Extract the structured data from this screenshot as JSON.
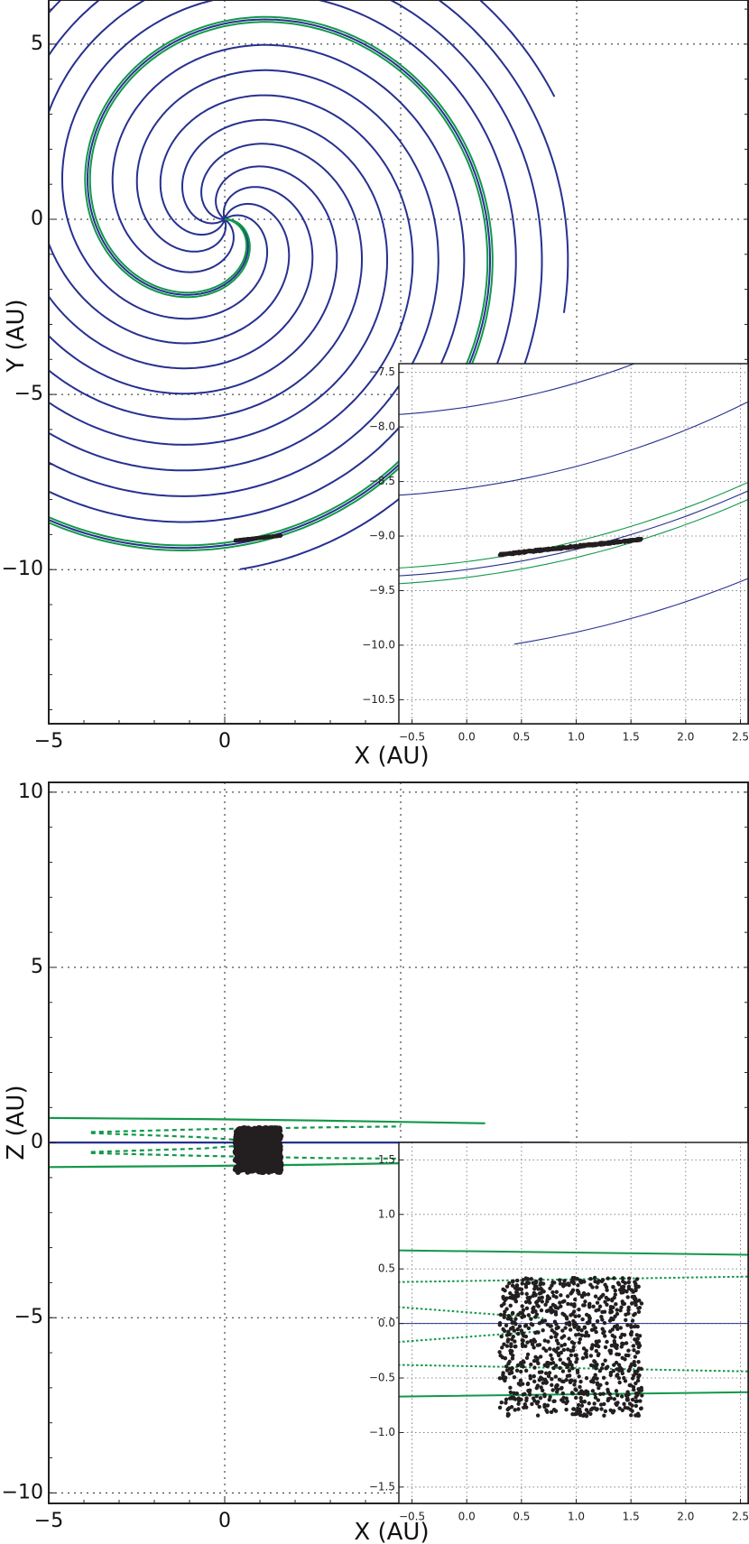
{
  "colors": {
    "field_line": "#27308f",
    "tilted_line": "#12984a",
    "particles": "#231f20",
    "grid": "#222222",
    "inset_grid": "#888888"
  },
  "chart_data": [
    {
      "id": "xy-main",
      "type": "line",
      "xlabel": "X (AU)",
      "ylabel": "Y (AU)",
      "xlim": [
        -5,
        14.87
      ],
      "ylim": [
        -14.4,
        6.26
      ],
      "grid": true,
      "xticks": [
        {
          "value": -5,
          "label": "−5"
        },
        {
          "value": 0,
          "label": "0"
        },
        {
          "value": 5,
          "label": ""
        },
        {
          "value": 10,
          "label": ""
        }
      ],
      "yticks": [
        {
          "value": 5,
          "label": "5"
        },
        {
          "value": 0,
          "label": "0"
        },
        {
          "value": -5,
          "label": "−5"
        },
        {
          "value": -10,
          "label": "−10"
        }
      ],
      "spiral_blue": {
        "arms": 10,
        "arm_start_angles_deg": [
          0,
          36,
          72,
          108,
          144,
          180,
          216,
          252,
          288,
          324
        ],
        "r_per_radian_au": 1.185,
        "r_max_au": 10
      },
      "spiral_green": {
        "arm_start_angles_deg": [
          -3.5,
          3.5
        ],
        "r_per_radian_au": 1.185,
        "r_max_au": 10.05
      },
      "particles": {
        "x_range": [
          0.3,
          1.6
        ],
        "y_at_x_min": -9.17,
        "y_at_x_max": -9.03,
        "count": 500
      }
    },
    {
      "id": "xy-inset",
      "type": "line",
      "xlim": [
        -0.62,
        2.57
      ],
      "ylim": [
        -10.72,
        -7.42
      ],
      "grid": true,
      "xticks": [
        {
          "value": -0.5,
          "label": "−0.5"
        },
        {
          "value": 0,
          "label": "0.0"
        },
        {
          "value": 0.5,
          "label": "0.5"
        },
        {
          "value": 1,
          "label": "1.0"
        },
        {
          "value": 1.5,
          "label": "1.5"
        },
        {
          "value": 2,
          "label": "2.0"
        },
        {
          "value": 2.5,
          "label": "2.5"
        }
      ],
      "yticks": [
        {
          "value": -7.5,
          "label": "−7.5"
        },
        {
          "value": -8,
          "label": "−8.0"
        },
        {
          "value": -8.5,
          "label": "−8.5"
        },
        {
          "value": -9,
          "label": "−9.0"
        },
        {
          "value": -9.5,
          "label": "−9.5"
        },
        {
          "value": -10,
          "label": "−10.0"
        },
        {
          "value": -10.5,
          "label": "−10.5"
        }
      ]
    },
    {
      "id": "xz-main",
      "type": "line",
      "xlabel": "X (AU)",
      "ylabel": "Z (AU)",
      "xlim": [
        -5,
        14.87
      ],
      "ylim": [
        -10.3,
        10.28
      ],
      "grid": true,
      "xticks": [
        {
          "value": -5,
          "label": "−5"
        },
        {
          "value": 0,
          "label": "0"
        },
        {
          "value": 5,
          "label": ""
        },
        {
          "value": 10,
          "label": ""
        }
      ],
      "yticks": [
        {
          "value": 10,
          "label": "10"
        },
        {
          "value": 5,
          "label": "5"
        },
        {
          "value": 0,
          "label": "0"
        },
        {
          "value": -5,
          "label": "−5"
        },
        {
          "value": -10,
          "label": "−10"
        }
      ],
      "lines": [
        {
          "color": "field_line",
          "style": "solid",
          "points": [
            [
              -5,
              0
            ],
            [
              9.8,
              0
            ]
          ]
        },
        {
          "color": "tilted_line",
          "style": "solid",
          "points": [
            [
              -5,
              0.7
            ],
            [
              -0.62,
              0.67
            ],
            [
              2.6,
              0.63
            ],
            [
              7.4,
              0.55
            ]
          ]
        },
        {
          "color": "tilted_line",
          "style": "solid",
          "points": [
            [
              -5,
              -0.7
            ],
            [
              -0.62,
              -0.67
            ],
            [
              2.6,
              -0.63
            ],
            [
              7.4,
              -0.55
            ]
          ]
        },
        {
          "color": "tilted_line",
          "style": "dotted",
          "points": [
            [
              -3.8,
              0.3
            ],
            [
              -0.62,
              0.38
            ],
            [
              2.6,
              0.43
            ],
            [
              5,
              0.46
            ]
          ]
        },
        {
          "color": "tilted_line",
          "style": "dotted",
          "points": [
            [
              -3.8,
              0.27
            ],
            [
              -0.62,
              0.15
            ],
            [
              0.7,
              0.05
            ]
          ]
        },
        {
          "color": "tilted_line",
          "style": "dotted",
          "points": [
            [
              -3.8,
              -0.27
            ],
            [
              -0.62,
              -0.17
            ],
            [
              0.7,
              -0.07
            ]
          ]
        },
        {
          "color": "tilted_line",
          "style": "dotted",
          "points": [
            [
              -3.8,
              -0.3
            ],
            [
              -0.62,
              -0.38
            ],
            [
              2.6,
              -0.44
            ],
            [
              5,
              -0.46
            ]
          ]
        }
      ],
      "particles": {
        "x_range": [
          0.3,
          1.6
        ],
        "z_range": [
          -0.85,
          0.42
        ],
        "count": 900
      }
    },
    {
      "id": "xz-inset",
      "type": "scatter",
      "xlim": [
        -0.62,
        2.57
      ],
      "ylim": [
        -1.65,
        1.66
      ],
      "grid": true,
      "xticks": [
        {
          "value": -0.5,
          "label": "−0.5"
        },
        {
          "value": 0,
          "label": "0.0"
        },
        {
          "value": 0.5,
          "label": "0.5"
        },
        {
          "value": 1,
          "label": "1.0"
        },
        {
          "value": 1.5,
          "label": "1.5"
        },
        {
          "value": 2,
          "label": "2.0"
        },
        {
          "value": 2.5,
          "label": "2.5"
        }
      ],
      "yticks": [
        {
          "value": 1.5,
          "label": "1.5"
        },
        {
          "value": 1,
          "label": "1.0"
        },
        {
          "value": 0.5,
          "label": "0.5"
        },
        {
          "value": 0,
          "label": "0.0"
        },
        {
          "value": -0.5,
          "label": "−0.5"
        },
        {
          "value": -1,
          "label": "−1.0"
        },
        {
          "value": -1.5,
          "label": "−1.5"
        }
      ]
    }
  ]
}
